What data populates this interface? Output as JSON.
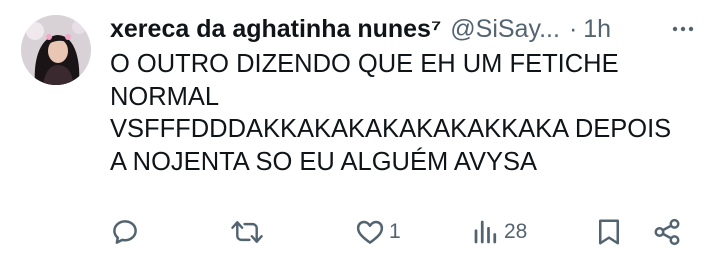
{
  "tweet": {
    "display_name": "xereca da aghatinha nunes⁷",
    "handle": "@SiSay...",
    "separator": "·",
    "time": "1h",
    "text_lines": [
      "O OUTRO DIZENDO QUE EH UM FETICHE",
      "NORMAL",
      "VSFFFDDDAKKAKAKAKAKAKAKKAKA DEPOIS",
      "A NOJENTA SO EU ALGUÉM AVYSA"
    ]
  },
  "actions": {
    "reply_count": "",
    "retweet_count": "",
    "like_count": "1",
    "views_count": "28"
  },
  "colors": {
    "text": "#0f1419",
    "muted": "#536471",
    "background": "#ffffff"
  },
  "icons": [
    "avatar",
    "more-icon",
    "reply-icon",
    "retweet-icon",
    "like-icon",
    "views-icon",
    "bookmark-icon",
    "share-icon"
  ]
}
